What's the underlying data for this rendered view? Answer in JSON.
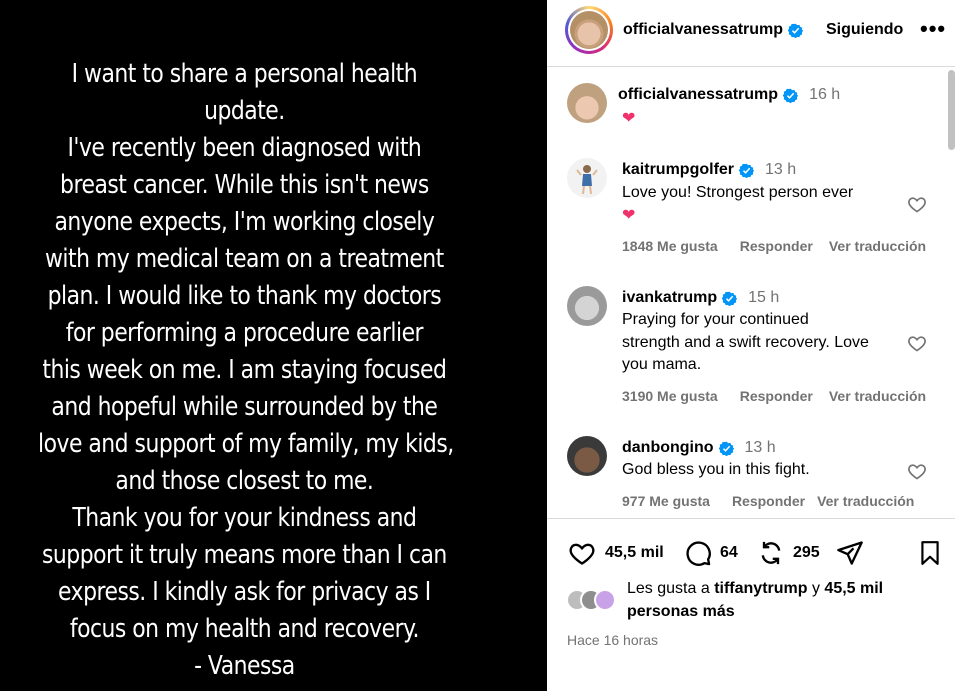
{
  "story": {
    "lines": [
      "I want to share a personal health",
      "update.",
      "I've recently been diagnosed with",
      "breast cancer. While this isn't news",
      "anyone expects, I'm working closely",
      "with my medical team on a treatment",
      "plan. I would like to thank my doctors",
      "for performing a procedure earlier",
      "this week on me. I am staying focused",
      "and hopeful while surrounded by the",
      "love and support of my family, my kids,",
      "and those closest to me.",
      "Thank you for your kindness and",
      "support it truly means more than I can",
      "express. I kindly ask for privacy as I",
      "focus on my health and recovery.",
      "- Vanessa"
    ]
  },
  "header": {
    "username": "officialvanessatrump",
    "follow_label": "Siguiendo",
    "more_label": "•••"
  },
  "caption": {
    "username": "officialvanessatrump",
    "time": "16 h",
    "text": "❤"
  },
  "comments": [
    {
      "username": "kaitrumpgolfer",
      "time": "13 h",
      "text": "Love you! Strongest person ever",
      "emoji": "❤",
      "likes": "1848 Me gusta",
      "reply": "Responder",
      "translate": "Ver traducción"
    },
    {
      "username": "ivankatrump",
      "time": "15 h",
      "text_lines": [
        "Praying for your continued",
        "strength and a swift recovery. Love",
        "you mama."
      ],
      "likes": "3190 Me gusta",
      "reply": "Responder",
      "translate": "Ver traducción"
    },
    {
      "username": "danbongino",
      "time": "13 h",
      "text": "God bless you in this fight.",
      "likes": "977 Me gusta",
      "reply": "Responder",
      "translate": "Ver traducción"
    }
  ],
  "actions": {
    "likes_count": "45,5 mil",
    "comments_count": "64",
    "reposts_count": "295"
  },
  "liked_by": {
    "prefix": "Les gusta a",
    "user": "tiffanytrump",
    "conjunction": "y",
    "others": "45,5 mil",
    "suffix": "personas más"
  },
  "time_ago": "Hace 16 horas",
  "colors": {
    "verified": "#0095f6",
    "heart_emoji": "#f0326c",
    "meta_gray": "#737373"
  }
}
